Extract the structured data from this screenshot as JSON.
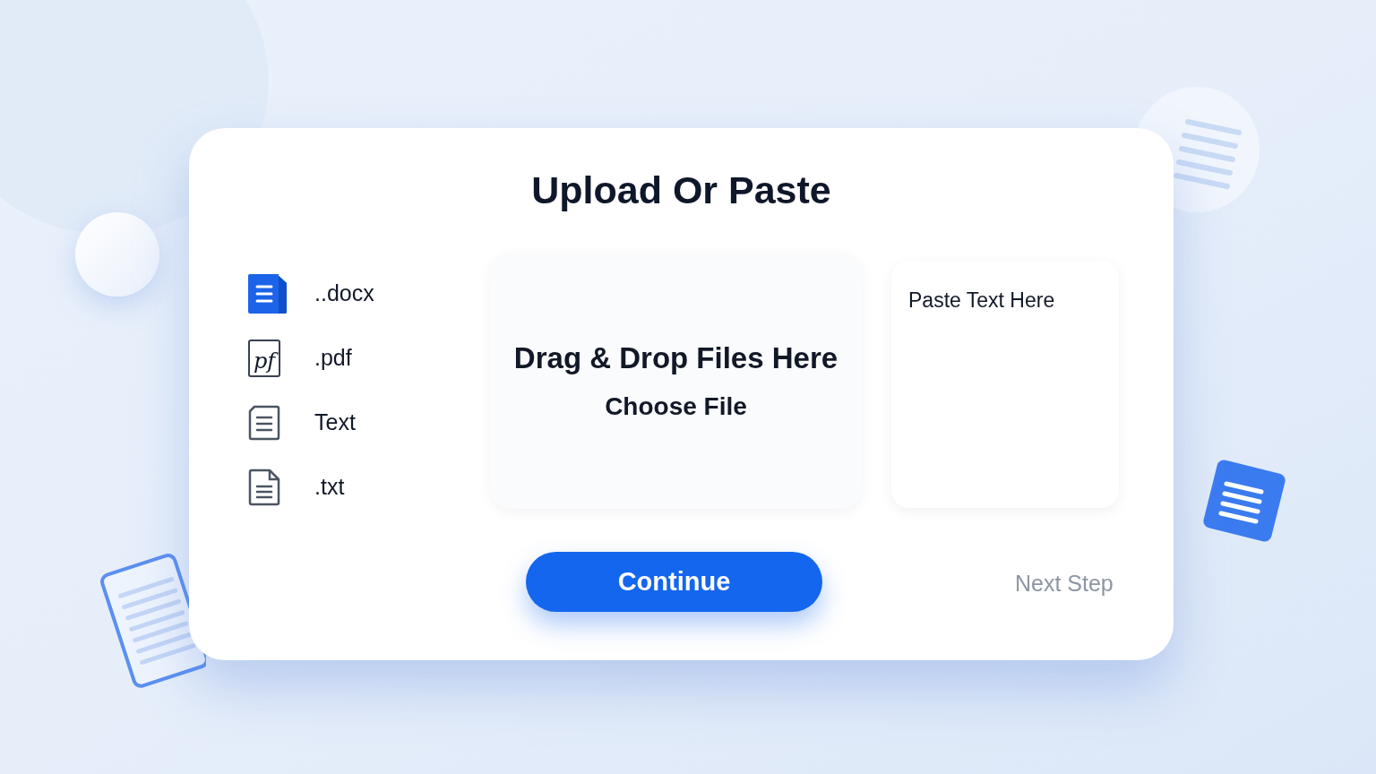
{
  "title": "Upload Or Paste",
  "file_types": [
    {
      "kind": "docx",
      "label": "..docx"
    },
    {
      "kind": "pdf",
      "label": ".pdf",
      "icon_text": "pf"
    },
    {
      "kind": "text",
      "label": "Text"
    },
    {
      "kind": "txt",
      "label": ".txt"
    }
  ],
  "drop_zone": {
    "heading": "Drag & Drop Files Here",
    "choose_file": "Choose File"
  },
  "paste_box": {
    "placeholder": "Paste Text Here"
  },
  "continue_button": "Continue",
  "next_step": "Next Step"
}
